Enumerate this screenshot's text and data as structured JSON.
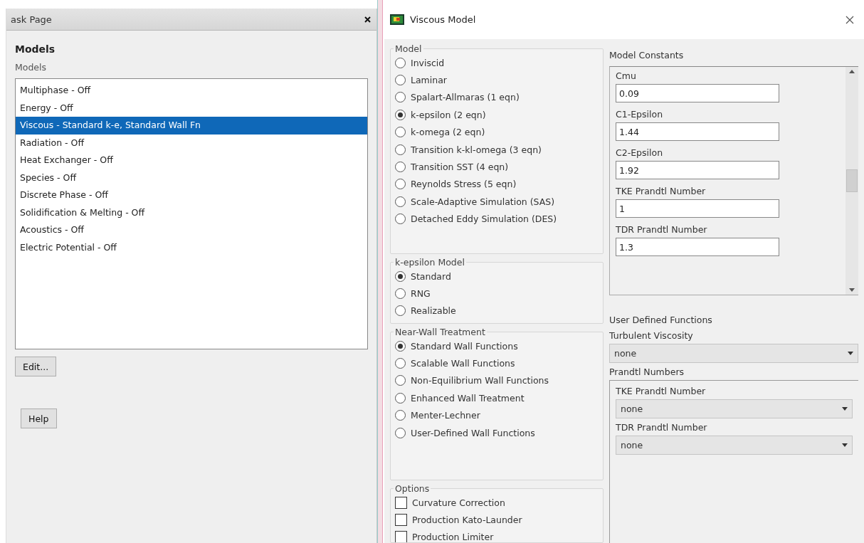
{
  "task_page": {
    "title": "ask Page",
    "heading": "Models",
    "list_label": "Models",
    "models": [
      {
        "label": "Multiphase - Off",
        "selected": false
      },
      {
        "label": "Energy - Off",
        "selected": false
      },
      {
        "label": "Viscous - Standard k-e, Standard Wall Fn",
        "selected": true
      },
      {
        "label": "Radiation - Off",
        "selected": false
      },
      {
        "label": "Heat Exchanger - Off",
        "selected": false
      },
      {
        "label": "Species - Off",
        "selected": false
      },
      {
        "label": "Discrete Phase - Off",
        "selected": false
      },
      {
        "label": "Solidification & Melting - Off",
        "selected": false
      },
      {
        "label": "Acoustics - Off",
        "selected": false
      },
      {
        "label": "Electric Potential - Off",
        "selected": false
      }
    ],
    "edit_button": "Edit...",
    "help_button": "Help"
  },
  "dialog": {
    "title": "Viscous Model",
    "model": {
      "title": "Model",
      "options": [
        {
          "label": "Inviscid",
          "selected": false
        },
        {
          "label": "Laminar",
          "selected": false
        },
        {
          "label": "Spalart-Allmaras (1 eqn)",
          "selected": false
        },
        {
          "label": "k-epsilon (2 eqn)",
          "selected": true
        },
        {
          "label": "k-omega (2 eqn)",
          "selected": false
        },
        {
          "label": "Transition k-kl-omega (3 eqn)",
          "selected": false
        },
        {
          "label": "Transition SST (4 eqn)",
          "selected": false
        },
        {
          "label": "Reynolds Stress (5 eqn)",
          "selected": false
        },
        {
          "label": "Scale-Adaptive Simulation (SAS)",
          "selected": false
        },
        {
          "label": "Detached Eddy Simulation (DES)",
          "selected": false
        }
      ]
    },
    "k_epsilon_model": {
      "title": "k-epsilon Model",
      "options": [
        {
          "label": "Standard",
          "selected": true
        },
        {
          "label": "RNG",
          "selected": false
        },
        {
          "label": "Realizable",
          "selected": false
        }
      ]
    },
    "near_wall_treatment": {
      "title": "Near-Wall Treatment",
      "options": [
        {
          "label": "Standard Wall Functions",
          "selected": true
        },
        {
          "label": "Scalable Wall Functions",
          "selected": false
        },
        {
          "label": "Non-Equilibrium Wall Functions",
          "selected": false
        },
        {
          "label": "Enhanced Wall Treatment",
          "selected": false
        },
        {
          "label": "Menter-Lechner",
          "selected": false
        },
        {
          "label": "User-Defined Wall Functions",
          "selected": false
        }
      ]
    },
    "options": {
      "title": "Options",
      "items": [
        {
          "label": "Curvature Correction",
          "checked": false
        },
        {
          "label": "Production Kato-Launder",
          "checked": false
        },
        {
          "label": "Production Limiter",
          "checked": false
        }
      ]
    },
    "model_constants": {
      "title": "Model Constants",
      "fields": [
        {
          "label": "Cmu",
          "value": "0.09"
        },
        {
          "label": "C1-Epsilon",
          "value": "1.44"
        },
        {
          "label": "C2-Epsilon",
          "value": "1.92"
        },
        {
          "label": "TKE Prandtl Number",
          "value": "1"
        },
        {
          "label": "TDR Prandtl Number",
          "value": "1.3"
        }
      ]
    },
    "user_defined_functions": {
      "title": "User Defined Functions",
      "turbulent_viscosity": {
        "label": "Turbulent Viscosity",
        "value": "none"
      },
      "prandtl_numbers": {
        "title": "Prandtl Numbers",
        "fields": [
          {
            "label": "TKE Prandtl Number",
            "value": "none"
          },
          {
            "label": "TDR Prandtl Number",
            "value": "none"
          }
        ]
      }
    }
  }
}
